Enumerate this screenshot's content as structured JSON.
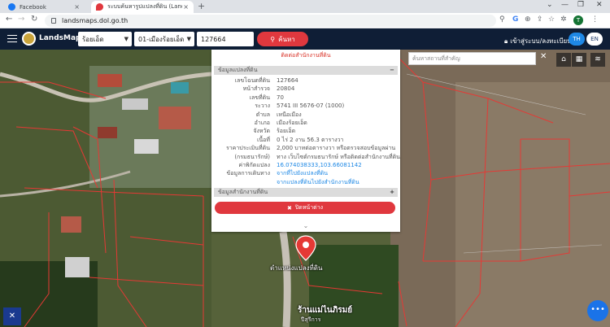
{
  "browser": {
    "tabs": [
      {
        "title": "Facebook",
        "favicon_color": "#1877f2"
      },
      {
        "title": "ระบบค้นหารูปแปลงที่ดิน (LandsMaps)",
        "favicon_color": "#e0383e"
      }
    ],
    "close_glyph": "×",
    "new_tab_glyph": "+",
    "url": "landsmaps.dol.go.th",
    "profile_initial": "T",
    "window_controls": [
      "⌄",
      "—",
      "❐",
      "✕"
    ]
  },
  "app": {
    "brand": "LandsMaps",
    "province": "ร้อยเอ็ด",
    "district": "01-เมืองร้อยเอ็ด",
    "parcel_input": "127664",
    "search_label": "ค้นหา",
    "login_label": "เข้าสู่ระบบ/ลงทะเบียน",
    "lang_th": "TH",
    "lang_en": "EN"
  },
  "panel": {
    "top_note": "ติดต่อสำนักงานที่ดิน",
    "section1_title": "ข้อมูลแปลงที่ดิน",
    "section1_symbol": "−",
    "rows": [
      {
        "label": "เลขโฉนดที่ดิน",
        "value": "127664",
        "link": false
      },
      {
        "label": "หน้าสำรวจ",
        "value": "20804",
        "link": false
      },
      {
        "label": "เลขที่ดิน",
        "value": "70",
        "link": false
      },
      {
        "label": "ระวาง",
        "value": "5741 III 5676-07 (1000)",
        "link": false
      },
      {
        "label": "ตำบล",
        "value": "เหนือเมือง",
        "link": false
      },
      {
        "label": "อำเภอ",
        "value": "เมืองร้อยเอ็ด",
        "link": false
      },
      {
        "label": "จังหวัด",
        "value": "ร้อยเอ็ด",
        "link": false
      },
      {
        "label": "เนื้อที่",
        "value": "0 ไร่ 2 งาน 56.3 ตารางวา",
        "link": false
      },
      {
        "label": "ราคาประเมินที่ดิน",
        "value": "2,000 บาทต่อตารางวา หรือตรวจสอบข้อมูลผ่าน",
        "link": false
      },
      {
        "label": "(กรมธนารักษ์)",
        "value": "ทาง เว็บไซต์กรมธนารักษ์ หรือติดต่อสำนักงานที่ดิน",
        "link": false
      },
      {
        "label": "ค่าพิกัดแปลง",
        "value": "16.074038333,103.66081142",
        "link": true
      },
      {
        "label": "ข้อมูลการเดินทาง",
        "value": "จากที่ไปยังแปลงที่ดิน",
        "link": true
      },
      {
        "label": "",
        "value": "จากแปลงที่ดินไปยังสำนักงานที่ดิน",
        "link": true
      }
    ],
    "section2_title": "ข้อมูลสำนักงานที่ดิน",
    "section2_symbol": "+",
    "close_label": "ปิดหน้าต่าง",
    "close_glyph": "✖",
    "chevron_glyph": "⌄"
  },
  "map": {
    "poi_placeholder": "ค้นหาสถานที่สำคัญ",
    "poi_clear_glyph": "✕",
    "marker_label": "ตำแหน่งแปลงที่ดิน",
    "shop_label": "ร้านแม่ไนภิรมย์",
    "shop_sub": "ปีสุรีการ",
    "controls": [
      "⌂",
      "▦",
      "≋"
    ],
    "fab_glyph": "•••",
    "tool_glyph": "✕"
  }
}
